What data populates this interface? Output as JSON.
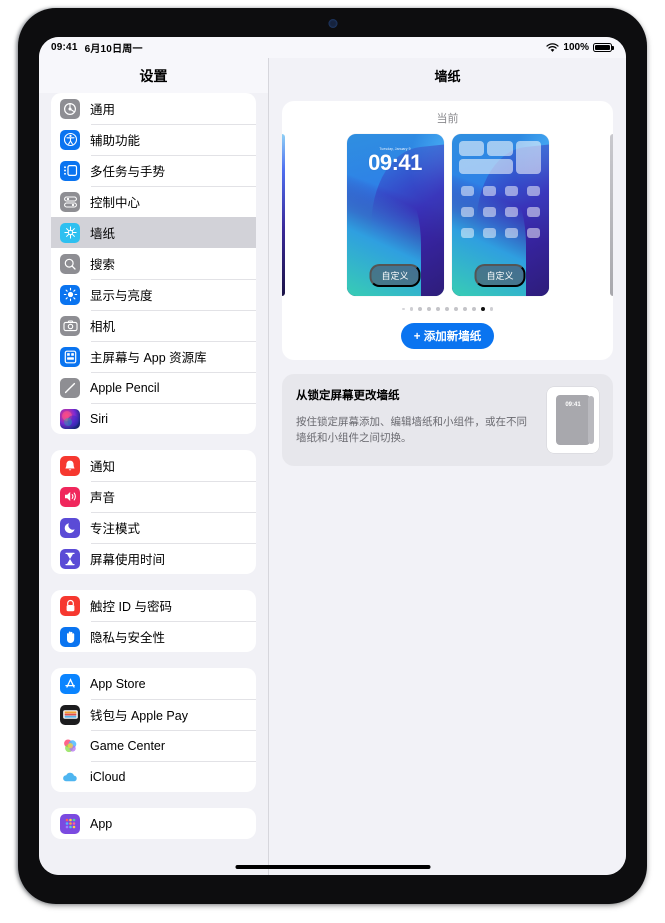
{
  "statusbar": {
    "time": "09:41",
    "date": "6月10日周一",
    "battery_percent": "100%",
    "wifi_icon": "wifi-icon",
    "battery_icon": "battery-icon"
  },
  "sidebar": {
    "title": "设置",
    "groups": [
      {
        "items": [
          {
            "label": "通用",
            "icon": "gear-icon",
            "selected": false
          },
          {
            "label": "辅助功能",
            "icon": "accessibility-icon",
            "selected": false
          },
          {
            "label": "多任务与手势",
            "icon": "multitasking-icon",
            "selected": false
          },
          {
            "label": "控制中心",
            "icon": "control-center-icon",
            "selected": false
          },
          {
            "label": "墙纸",
            "icon": "wallpaper-icon",
            "selected": true
          },
          {
            "label": "搜索",
            "icon": "search-icon",
            "selected": false
          },
          {
            "label": "显示与亮度",
            "icon": "brightness-icon",
            "selected": false
          },
          {
            "label": "相机",
            "icon": "camera-icon",
            "selected": false
          },
          {
            "label": "主屏幕与 App 资源库",
            "icon": "home-screen-icon",
            "selected": false
          },
          {
            "label": "Apple Pencil",
            "icon": "pencil-icon",
            "selected": false
          },
          {
            "label": "Siri",
            "icon": "siri-icon",
            "selected": false
          }
        ]
      },
      {
        "items": [
          {
            "label": "通知",
            "icon": "notifications-icon",
            "selected": false
          },
          {
            "label": "声音",
            "icon": "sound-icon",
            "selected": false
          },
          {
            "label": "专注模式",
            "icon": "focus-moon-icon",
            "selected": false
          },
          {
            "label": "屏幕使用时间",
            "icon": "screen-time-icon",
            "selected": false
          }
        ]
      },
      {
        "items": [
          {
            "label": "触控 ID 与密码",
            "icon": "touch-id-lock-icon",
            "selected": false
          },
          {
            "label": "隐私与安全性",
            "icon": "privacy-hand-icon",
            "selected": false
          }
        ]
      },
      {
        "items": [
          {
            "label": "App Store",
            "icon": "app-store-icon",
            "selected": false
          },
          {
            "label": "钱包与 Apple Pay",
            "icon": "wallet-icon",
            "selected": false
          },
          {
            "label": "Game Center",
            "icon": "game-center-icon",
            "selected": false
          },
          {
            "label": "iCloud",
            "icon": "icloud-icon",
            "selected": false
          }
        ]
      },
      {
        "items": [
          {
            "label": "App",
            "icon": "apps-grid-icon",
            "selected": false
          }
        ]
      }
    ]
  },
  "detail": {
    "title": "墙纸",
    "current_card": {
      "heading": "当前",
      "lock_preview": {
        "name": "lock-screen-preview",
        "date_text": "Tuesday, January 9",
        "time_text": "09:41",
        "customize_label": "自定义"
      },
      "home_preview": {
        "name": "home-screen-preview",
        "customize_label": "自定义"
      },
      "page_dots": {
        "total": 11,
        "active_index": 9
      },
      "add_button_label": "+ 添加新墙纸"
    },
    "info_card": {
      "title": "从锁定屏幕更改墙纸",
      "body": "按住锁定屏幕添加、编辑墙纸和小组件，或在不同墙纸和小组件之间切换。",
      "mini_time": "09:41"
    }
  },
  "colors": {
    "accent_blue": "#0a74f0",
    "selected_row": "#d2d2d8",
    "sidebar_bg": "#f1f1f6",
    "detail_bg": "#f2f2f7"
  }
}
